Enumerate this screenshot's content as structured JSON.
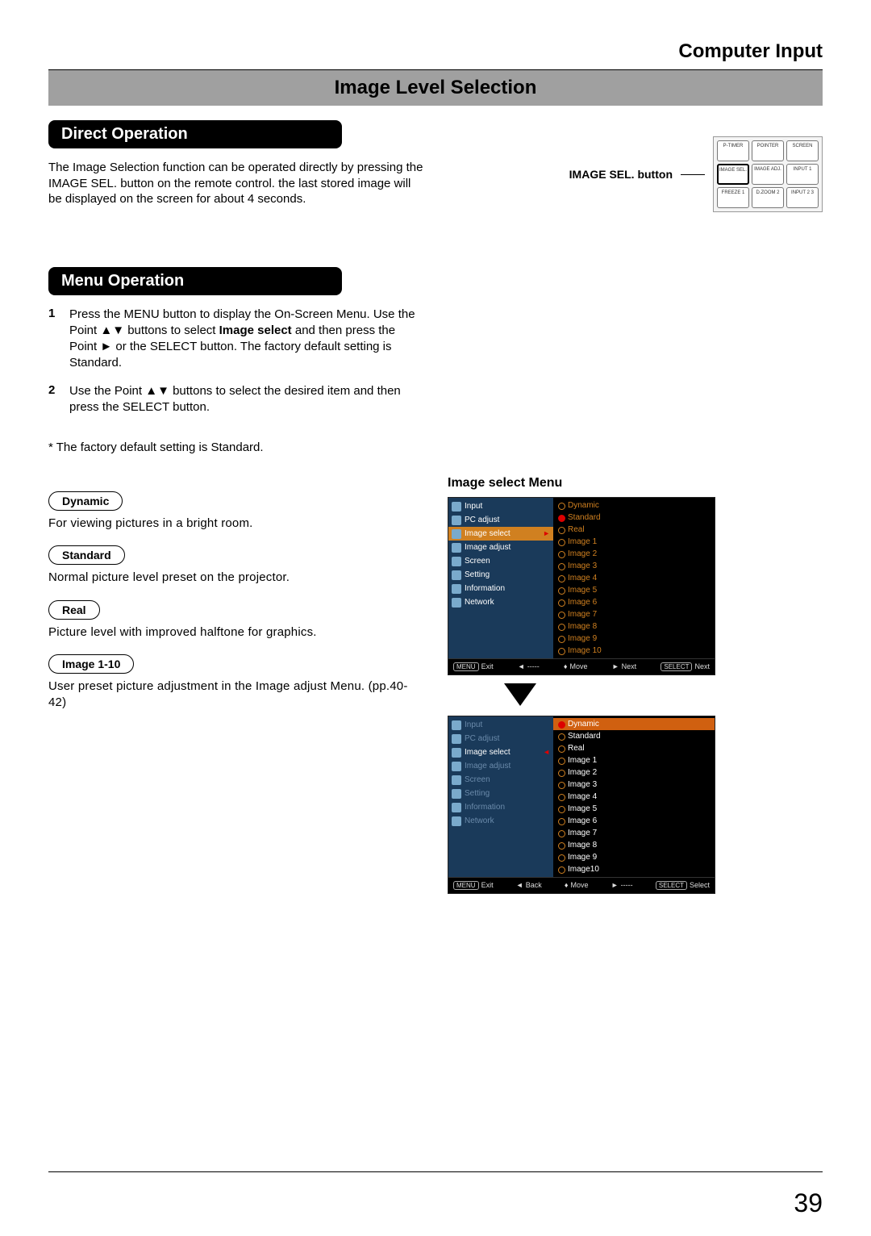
{
  "header": {
    "section": "Computer Input",
    "banner": "Image Level Selection"
  },
  "direct": {
    "heading": "Direct Operation",
    "body": "The Image Selection function can be operated directly by pressing the IMAGE SEL. button on the remote control. the last stored image will be displayed on the screen for about 4 seconds.",
    "remote_label": "IMAGE SEL. button",
    "remote_buttons": {
      "r1c1": "P-TIMER",
      "r1c2": "POINTER",
      "r1c3": "SCREEN",
      "r2c1": "IMAGE SEL.",
      "r2c2": "IMAGE ADJ.",
      "r2c3": "INPUT 1",
      "r3c1": "FREEZE 1",
      "r3c2": "D.ZOOM 2",
      "r3c3": "INPUT 2 3"
    }
  },
  "menu": {
    "heading": "Menu Operation",
    "steps": [
      {
        "num": "1",
        "text_before": "Press the MENU button to display the On-Screen Menu. Use the Point ▲▼ buttons to select ",
        "bold": "Image select",
        "text_after": " and then press the Point ► or the SELECT button. The factory default setting is Standard."
      },
      {
        "num": "2",
        "text_before": "Use the Point ▲▼ buttons to select the desired item and then press the SELECT button.",
        "bold": "",
        "text_after": ""
      }
    ],
    "note": "* The factory default setting is Standard.",
    "modes": [
      {
        "name": "Dynamic",
        "desc": "For viewing pictures in a bright room."
      },
      {
        "name": "Standard",
        "desc": "Normal picture level preset on the projector."
      },
      {
        "name": "Real",
        "desc": "Picture level with improved halftone for graphics."
      },
      {
        "name": "Image 1-10",
        "desc": "User preset picture adjustment in the Image adjust Menu. (pp.40-42)"
      }
    ]
  },
  "osd": {
    "title": "Image select Menu",
    "left_items": [
      "Input",
      "PC adjust",
      "Image select",
      "Image adjust",
      "Screen",
      "Setting",
      "Information",
      "Network"
    ],
    "right1": [
      "Dynamic",
      "Standard",
      "Real",
      "Image 1",
      "Image 2",
      "Image 3",
      "Image 4",
      "Image 5",
      "Image 6",
      "Image 7",
      "Image 8",
      "Image 9",
      "Image 10"
    ],
    "right2": [
      "Dynamic",
      "Standard",
      "Real",
      "Image 1",
      "Image 2",
      "Image 3",
      "Image 4",
      "Image 5",
      "Image 6",
      "Image 7",
      "Image 8",
      "Image 9",
      "Image10"
    ],
    "foot1": {
      "exit": "Exit",
      "back": "-----",
      "move": "Move",
      "next": "Next",
      "sel": "Next"
    },
    "foot2": {
      "exit": "Exit",
      "back": "Back",
      "move": "Move",
      "next": "-----",
      "sel": "Select"
    }
  },
  "page_number": "39"
}
